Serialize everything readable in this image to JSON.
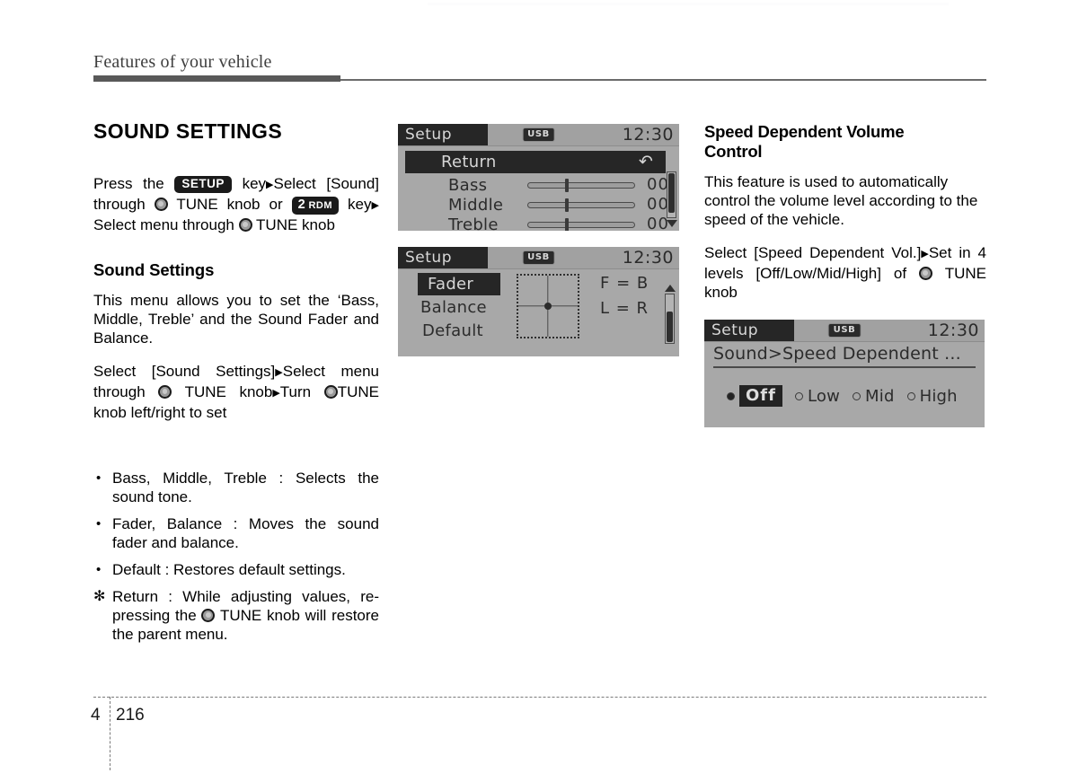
{
  "page": {
    "chapter_title": "Features of your vehicle",
    "chapter_number": "4",
    "page_number": "216"
  },
  "left_column": {
    "section_title": "SOUND SETTINGS",
    "intro": {
      "part1": "Press   the",
      "key_setup": "SETUP",
      "part2": "key",
      "part3": "Select [Sound] through",
      "knob1": "tune-knob",
      "part4": "TUNE knob or",
      "key_rdm_big": "2",
      "key_rdm_small": "RDM",
      "part5": "key",
      "part6": "Select menu through",
      "part7": "TUNE knob"
    },
    "sub_title": "Sound Settings",
    "para1": "This menu allows you to set the ‘Bass, Middle, Treble’ and the Sound Fader and Balance.",
    "para2": {
      "p1": "Select   [Sound   Settings]",
      "p2": "Select menu through",
      "p3": "TUNE knob",
      "p4": "Turn",
      "p5": "TUNE knob left/right to set"
    },
    "bullets": [
      {
        "marker": "•",
        "marker_type": "dot",
        "text": "Bass, Middle, Treble : Selects the sound tone."
      },
      {
        "marker": "•",
        "marker_type": "dot",
        "text": "Fader, Balance : Moves the sound fader and balance."
      },
      {
        "marker": "•",
        "marker_type": "dot",
        "text": "Default : Restores default settings."
      }
    ],
    "note": {
      "marker": "✻",
      "p1": "Return : While adjusting values, re-pressing the",
      "p2": "TUNE knob will restore the parent menu."
    }
  },
  "screen_bass": {
    "title": "Setup",
    "source_badge": "USB",
    "clock": "12:30",
    "rows": [
      {
        "label": "Return",
        "value": "",
        "highlighted": true,
        "icon": "return-arrow-icon"
      },
      {
        "label": "Bass",
        "value": "00",
        "highlighted": false
      },
      {
        "label": "Middle",
        "value": "00",
        "highlighted": false
      },
      {
        "label": "Treble",
        "value": "00",
        "highlighted": false
      }
    ],
    "scroll_position": "top"
  },
  "screen_fader": {
    "title": "Setup",
    "source_badge": "USB",
    "clock": "12:30",
    "rows": [
      {
        "label": "Fader",
        "highlighted": true
      },
      {
        "label": "Balance",
        "highlighted": false
      },
      {
        "label": "Default",
        "highlighted": false
      }
    ],
    "readouts": [
      {
        "text": "F = B"
      },
      {
        "text": "L = R"
      }
    ],
    "scroll_position": "bottom"
  },
  "right_column": {
    "sub_title_line1": "Speed Dependent Volume",
    "sub_title_line2": "Control",
    "para1": "This feature is used to automatically control the volume level according to the speed of the vehicle.",
    "para2": {
      "p1": "Select [Speed Dependent Vol.]",
      "p2": "Set in 4 levels [Off/Low/Mid/High] of",
      "p3": "TUNE knob"
    }
  },
  "screen_speed": {
    "title": "Setup",
    "source_badge": "USB",
    "clock": "12:30",
    "breadcrumb": "Sound>Speed Dependent ...",
    "options": [
      {
        "label": "Off",
        "selected": true
      },
      {
        "label": "Low",
        "selected": false
      },
      {
        "label": "Mid",
        "selected": false
      },
      {
        "label": "High",
        "selected": false
      }
    ]
  },
  "colors": {
    "lcd_background": "#a8a8a8",
    "lcd_dark": "#262626",
    "lcd_text": "#2b2b2b",
    "rule_dark": "#595959"
  }
}
